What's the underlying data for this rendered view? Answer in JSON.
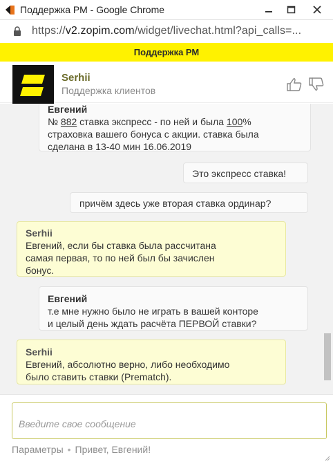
{
  "window": {
    "title": "Поддержка РМ - Google Chrome",
    "controls": [
      "minimize-icon",
      "maximize-icon",
      "close-icon"
    ]
  },
  "address_bar": {
    "scheme": "https://",
    "host": "v2.zopim.com",
    "path": "/widget/livechat.html?api_calls=..."
  },
  "header": {
    "title": "Поддержка РМ",
    "accent": "#fff200"
  },
  "agent": {
    "name": "Serhii",
    "role": "Поддержка клиентов",
    "rate_icons": [
      "thumbs-up-icon",
      "thumbs-down-icon"
    ]
  },
  "messages": [
    {
      "sender": "Евгений",
      "type": "visitor",
      "prefix": "№ ",
      "link1": "882",
      "mid1": " ставка экспресс - по ней и была ",
      "link2": "100",
      "mid2": "%",
      "line2": "страховка вашего бонуса с акции. ставка была",
      "line3": "сделана в 13-40 мин 16.06.2019"
    },
    {
      "type": "visitor",
      "text": "Это экспресс ставка!"
    },
    {
      "type": "visitor",
      "text": "причём здесь уже вторая ставка ординар?"
    },
    {
      "sender": "Serhii",
      "type": "agent",
      "line1": "Евгений, если бы ставка была рассчитана",
      "line2": "самая первая, то по ней был бы зачислен",
      "line3": "бонус."
    },
    {
      "sender": "Евгений",
      "type": "visitor",
      "line1": "т.е мне нужно было не играть в вашей конторе",
      "line2": "и целый день ждать расчёта ПЕРВОЙ ставки?"
    },
    {
      "sender": "Serhii",
      "type": "agent",
      "line1": "Евгений, абсолютно верно, либо необходимо",
      "line2": "было ставить ставки (Prematch)."
    }
  ],
  "composer": {
    "placeholder": "Введите свое сообщение",
    "value": ""
  },
  "footer": {
    "settings": "Параметры",
    "separator": "•",
    "greeting": "Привет, Евгений!"
  },
  "colors": {
    "agent_bubble": "#fdfdd4",
    "visitor_bubble": "#fafafa",
    "agent_name": "#6b6b2a"
  }
}
